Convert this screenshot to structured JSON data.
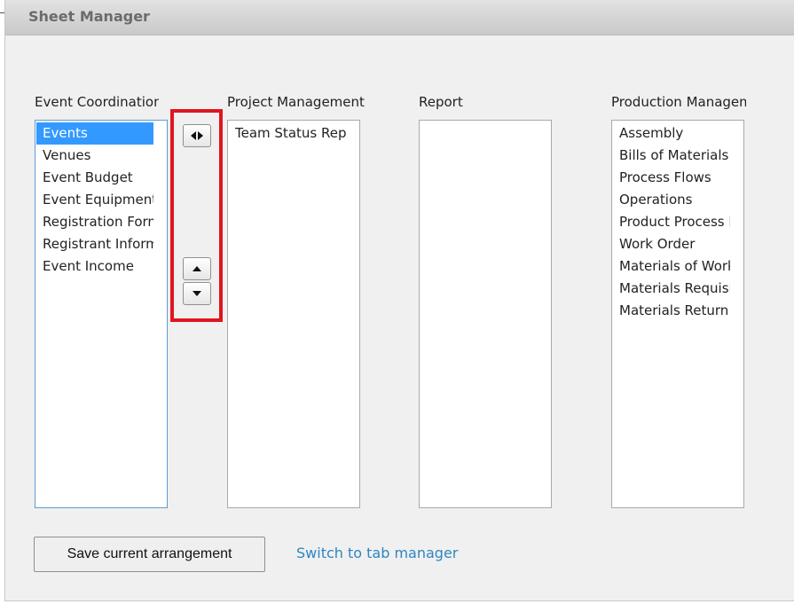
{
  "dialog": {
    "title": "Sheet Manager"
  },
  "columns": [
    {
      "label": "Event Coordination",
      "items": [
        "Events",
        "Venues",
        "Event Budget",
        "Event Equipment I",
        "Registration Form",
        "Registrant Informa",
        "Event Income"
      ],
      "selected_index": 0
    },
    {
      "label": "Project Management",
      "items": [
        "Team Status Repo"
      ]
    },
    {
      "label": "Report",
      "items": []
    },
    {
      "label": "Production Managem",
      "items": [
        "Assembly",
        "Bills of Materials (I",
        "Process Flows",
        "Operations",
        "Product Process Fl",
        "Work Order",
        "Materials of Work",
        "Materials Requisit",
        "Materials Return"
      ]
    }
  ],
  "controls": {
    "move_left_right_icon": "left-right-arrows-icon",
    "move_up_icon": "triangle-up-icon",
    "move_down_icon": "triangle-down-icon",
    "highlight_color": "#e0161f"
  },
  "footer": {
    "save_label": "Save current arrangement",
    "switch_link": "Switch to tab manager"
  },
  "colors": {
    "accent": "#3399ff",
    "link": "#2e86c1"
  }
}
